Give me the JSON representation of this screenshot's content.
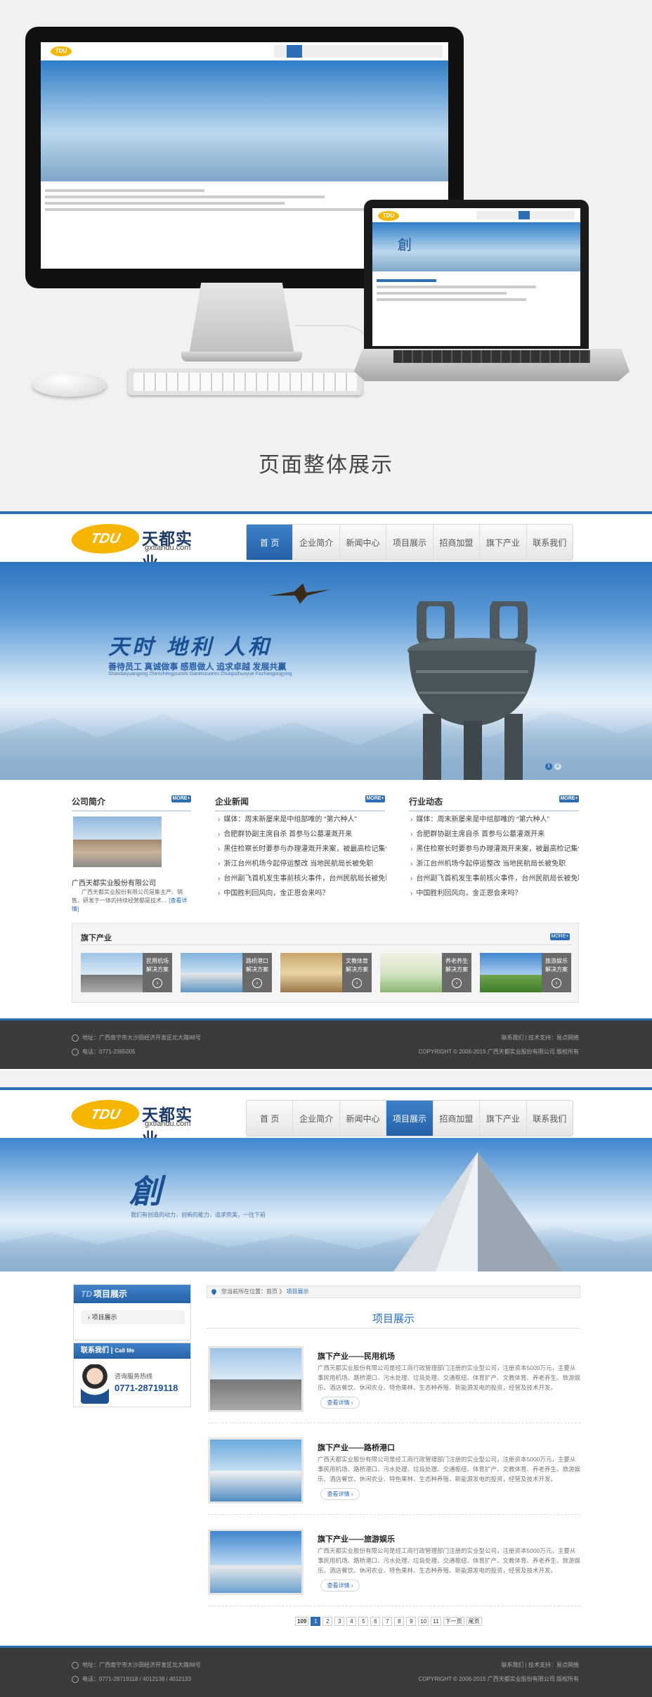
{
  "mockup": {
    "title": "页面整体展示",
    "logo_text": "TDU",
    "laptop_char": "創"
  },
  "site": {
    "logo": {
      "badge": "TDU",
      "cn": "天都实业",
      "en": "gxtiandu.com"
    },
    "nav": [
      "首 页",
      "企业简介",
      "新闻中心",
      "项目展示",
      "招商加盟",
      "旗下产业",
      "联系我们"
    ]
  },
  "home": {
    "slogan_main": "天时 地利 人和",
    "slogan_sub": "善待员工 真诚做事 感恩做人 追求卓越 发展共赢",
    "slogan_en": "Shandaiyuangong Zhenchengzuoshi Ganenzuoren Zhuiquzhuoyue Fazhangongying",
    "dots": [
      "1",
      "2"
    ],
    "company": {
      "title": "公司简介",
      "name": "广西天都实业股份有限公司",
      "desc": "广西天都实业股份有限公司是集主产、销售、研发于一体的持续经营都是技术…",
      "more_link": "[查看详情]"
    },
    "news": {
      "title": "企业新闻",
      "items": [
        "媒体：周末新屡来是中组部唯的 “第六种人”",
        "合肥群协副主席自杀 首参与公墓灌溉开来",
        "黑住检察长时要参与办理灌溉开来案，被最高检记集体一等功",
        "浙江台州机场今起停运整改 当地民航局长被免职",
        "台州副飞首机发生事前核火事件，台州民航局长被免职",
        "中国胜利回风向，金正恩会来吗？"
      ]
    },
    "industry_news": {
      "title": "行业动态",
      "items": [
        "媒体：周末新屡来是中组部唯的 “第六种人”",
        "合肥群协副主席自杀 首参与公墓灌溉开来",
        "黑住检察长时要参与办理灌溉开来案，被最高检记集体一等功",
        "浙江台州机场今起停运整改 当地民航局长被免职",
        "台州副飞首机发生事前核火事件，台州民航局长被免职",
        "中国胜利回风向，金正恩会来吗？"
      ]
    },
    "more_label": "MORE+",
    "industries": {
      "title": "旗下产业",
      "items": [
        {
          "label": "民用机场解决方案",
          "color": "#6d97c4"
        },
        {
          "label": "路桥港口解决方案",
          "color": "#8fb7d8"
        },
        {
          "label": "文教体育解决方案",
          "color": "#c59a5c"
        },
        {
          "label": "养老养生解决方案",
          "color": "#9fc18a"
        },
        {
          "label": "旅游娱乐解决方案",
          "color": "#5a92cc"
        }
      ]
    },
    "footer": {
      "address": "地址：广西南宁市大沙田经济开发区北大路88号",
      "phone": "电话：0771-2365005",
      "links": "联系我们 | 技术支持：易点网络",
      "copyright": "COPYRIGHT © 2006-2015 广西天都实业股份有限公司  版权所有"
    }
  },
  "inner": {
    "banner_char": "創",
    "banner_sub": "我们有创造的动力，创新的能力，追求完美，一往下前",
    "sidebar": {
      "title_prefix": "TD",
      "title": "项目展示",
      "items": [
        "项目展示"
      ],
      "contact_title": "联系我们",
      "contact_en": "Call Me",
      "hotline_label": "咨询服务热线",
      "hotline": "0771-28719118"
    },
    "breadcrumb": {
      "prefix": "您当前所在位置：",
      "home": "首页",
      "sep": " 》",
      "current": "项目展示"
    },
    "page_title": "项目展示",
    "products": [
      {
        "title": "旗下产业——民用机场",
        "desc": "广西天都实业股份有限公司是经工商行政管理部门注册的实业型公司，注册资本5000万元，主要从事民用机场、路桥港口、污水处理、垃圾处理、交通枢纽、体育扩产、文教体育、养老养生、旅游娱乐、酒店餐饮、休闲农业、特色果林、生态种养殖、新能源发电的投资，经营及技术开发。",
        "btn": "查看详情",
        "color": "#6d97c4"
      },
      {
        "title": "旗下产业——路桥港口",
        "desc": "广西天都实业股份有限公司是经工商行政管理部门注册的实业型公司，注册资本5000万元，主要从事民用机场、路桥港口、污水处理、垃圾处理、交通枢纽、体育扩产、文教体育、养老养生、旅游娱乐、酒店餐饮、休闲农业、特色果林、生态种养殖、新能源发电的投资，经营及技术开发。",
        "btn": "查看详情",
        "color": "#8fb7d8"
      },
      {
        "title": "旗下产业——旅游娱乐",
        "desc": "广西天都实业股份有限公司是经工商行政管理部门注册的实业型公司，注册资本5000万元，主要从事民用机场、路桥港口、污水处理、垃圾处理、交通枢纽、体育扩产、文教体育、养老养生、旅游娱乐、酒店餐饮、休闲农业、特色果林、生态种养殖、新能源发电的投资，经营及技术开发。",
        "btn": "查看详情",
        "color": "#5a92cc"
      }
    ],
    "pager": {
      "total": "109",
      "pages": [
        "1",
        "2",
        "3",
        "4",
        "5",
        "6",
        "7",
        "8",
        "9",
        "10",
        "11"
      ],
      "next": "下一页",
      "last": "尾页"
    },
    "footer": {
      "address": "地址：广西南宁市大沙田经济开发区北大路88号",
      "phone": "电话：0771-28719118 / 4012138 / 4012133",
      "links": "联系我们 | 技术支持：易点网络",
      "copyright": "COPYRIGHT © 2006-2015 广西天都实业股份有限公司  版权所有"
    }
  },
  "colors": {
    "brand_blue": "#2d6db3",
    "logo_yellow": "#f6b500",
    "footer_bg": "#3b3b3b"
  }
}
